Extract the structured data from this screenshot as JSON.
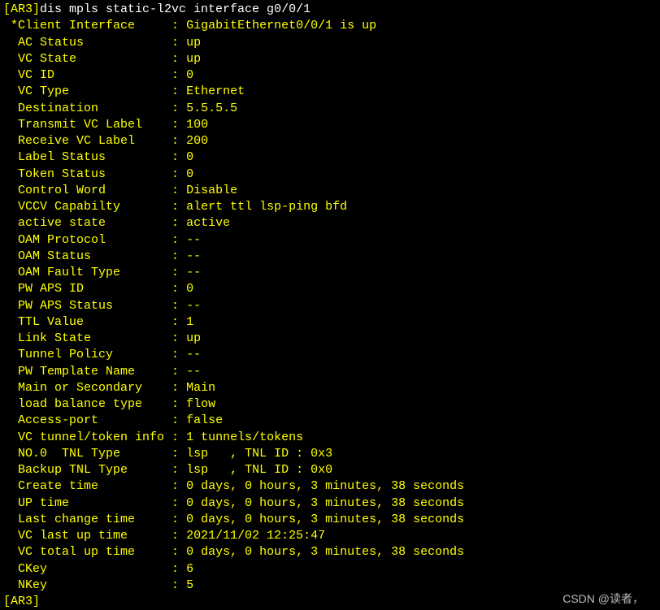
{
  "host": "[AR3]",
  "command": "dis mpls static-l2vc interface g0/0/1",
  "first_row": {
    "label": " *Client Interface     ",
    "sep": ": ",
    "value": "GigabitEthernet0/0/1 is up"
  },
  "rows": [
    {
      "label": "  AC Status            ",
      "sep": ": ",
      "value": "up"
    },
    {
      "label": "  VC State             ",
      "sep": ": ",
      "value": "up"
    },
    {
      "label": "  VC ID                ",
      "sep": ": ",
      "value": "0"
    },
    {
      "label": "  VC Type              ",
      "sep": ": ",
      "value": "Ethernet"
    },
    {
      "label": "  Destination          ",
      "sep": ": ",
      "value": "5.5.5.5"
    },
    {
      "label": "  Transmit VC Label    ",
      "sep": ": ",
      "value": "100"
    },
    {
      "label": "  Receive VC Label     ",
      "sep": ": ",
      "value": "200"
    },
    {
      "label": "  Label Status         ",
      "sep": ": ",
      "value": "0"
    },
    {
      "label": "  Token Status         ",
      "sep": ": ",
      "value": "0"
    },
    {
      "label": "  Control Word         ",
      "sep": ": ",
      "value": "Disable"
    },
    {
      "label": "  VCCV Capabilty       ",
      "sep": ": ",
      "value": "alert ttl lsp-ping bfd"
    },
    {
      "label": "  active state         ",
      "sep": ": ",
      "value": "active"
    },
    {
      "label": "  OAM Protocol         ",
      "sep": ": ",
      "value": "--"
    },
    {
      "label": "  OAM Status           ",
      "sep": ": ",
      "value": "--"
    },
    {
      "label": "  OAM Fault Type       ",
      "sep": ": ",
      "value": "--"
    },
    {
      "label": "  PW APS ID            ",
      "sep": ": ",
      "value": "0"
    },
    {
      "label": "  PW APS Status        ",
      "sep": ": ",
      "value": "--"
    },
    {
      "label": "  TTL Value            ",
      "sep": ": ",
      "value": "1"
    },
    {
      "label": "  Link State           ",
      "sep": ": ",
      "value": "up"
    },
    {
      "label": "  Tunnel Policy        ",
      "sep": ": ",
      "value": "--"
    },
    {
      "label": "  PW Template Name     ",
      "sep": ": ",
      "value": "--"
    },
    {
      "label": "  Main or Secondary    ",
      "sep": ": ",
      "value": "Main"
    },
    {
      "label": "  load balance type    ",
      "sep": ": ",
      "value": "flow"
    },
    {
      "label": "  Access-port          ",
      "sep": ": ",
      "value": "false"
    },
    {
      "label": "  VC tunnel/token info ",
      "sep": ": ",
      "value": "1 tunnels/tokens"
    },
    {
      "label": "  NO.0  TNL Type       ",
      "sep": ": ",
      "value": "lsp   , TNL ID : 0x3"
    },
    {
      "label": "  Backup TNL Type      ",
      "sep": ": ",
      "value": "lsp   , TNL ID : 0x0"
    },
    {
      "label": "  Create time          ",
      "sep": ": ",
      "value": "0 days, 0 hours, 3 minutes, 38 seconds"
    },
    {
      "label": "  UP time              ",
      "sep": ": ",
      "value": "0 days, 0 hours, 3 minutes, 38 seconds"
    },
    {
      "label": "  Last change time     ",
      "sep": ": ",
      "value": "0 days, 0 hours, 3 minutes, 38 seconds"
    },
    {
      "label": "  VC last up time      ",
      "sep": ": ",
      "value": "2021/11/02 12:25:47"
    },
    {
      "label": "  VC total up time     ",
      "sep": ": ",
      "value": "0 days, 0 hours, 3 minutes, 38 seconds"
    },
    {
      "label": "  CKey                 ",
      "sep": ": ",
      "value": "6"
    },
    {
      "label": "  NKey                 ",
      "sep": ": ",
      "value": "5"
    }
  ],
  "final_prompt": "[AR3]",
  "watermark": "CSDN @读者，"
}
